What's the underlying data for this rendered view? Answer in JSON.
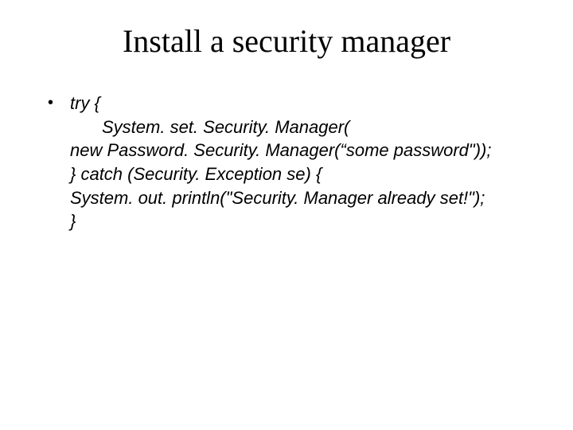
{
  "title": "Install a security manager",
  "bullet_glyph": "•",
  "code": {
    "l0": "try {",
    "l1": "System. set. Security. Manager(",
    "l2": "new Password. Security. Manager(“some password\"));",
    "l3": "} catch (Security. Exception se) {",
    "l4": "System. out. println(\"Security. Manager already set!\");",
    "l5": "}"
  }
}
